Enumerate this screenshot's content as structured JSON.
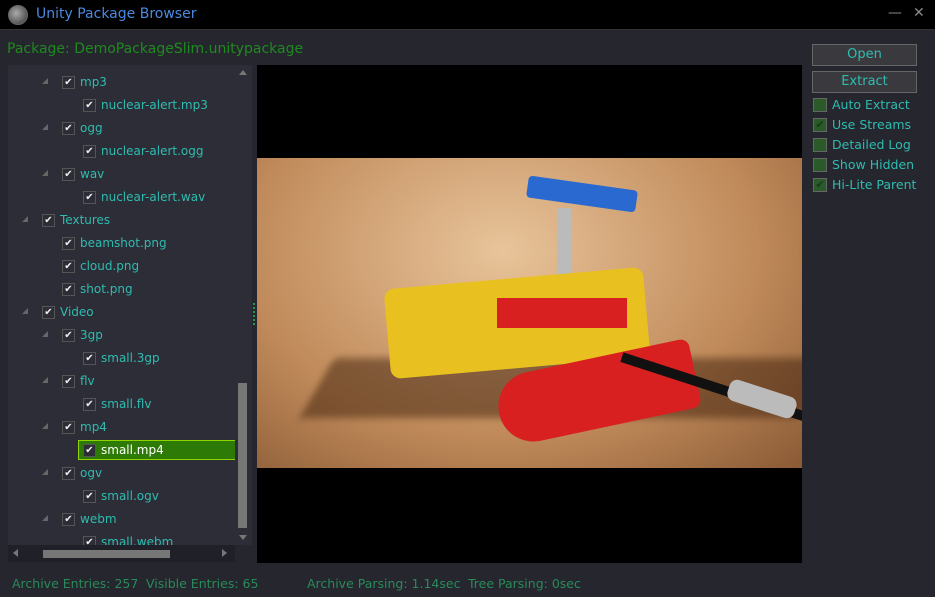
{
  "window": {
    "title": "Unity Package Browser",
    "minimize": "—",
    "close": "✕"
  },
  "package_label": "Package: DemoPackageSlim.unitypackage",
  "tree": [
    {
      "label": "mp3",
      "level": 1,
      "expander": true,
      "checked": true
    },
    {
      "label": "nuclear-alert.mp3",
      "level": 2,
      "expander": false,
      "checked": true
    },
    {
      "label": "ogg",
      "level": 1,
      "expander": true,
      "checked": true
    },
    {
      "label": "nuclear-alert.ogg",
      "level": 2,
      "expander": false,
      "checked": true
    },
    {
      "label": "wav",
      "level": 1,
      "expander": true,
      "checked": true
    },
    {
      "label": "nuclear-alert.wav",
      "level": 2,
      "expander": false,
      "checked": true
    },
    {
      "label": "Textures",
      "level": 0,
      "expander": true,
      "checked": true
    },
    {
      "label": "beamshot.png",
      "level": 1,
      "expander": false,
      "checked": true
    },
    {
      "label": "cloud.png",
      "level": 1,
      "expander": false,
      "checked": true
    },
    {
      "label": "shot.png",
      "level": 1,
      "expander": false,
      "checked": true
    },
    {
      "label": "Video",
      "level": 0,
      "expander": true,
      "checked": true
    },
    {
      "label": "3gp",
      "level": 1,
      "expander": true,
      "checked": true
    },
    {
      "label": "small.3gp",
      "level": 2,
      "expander": false,
      "checked": true
    },
    {
      "label": "flv",
      "level": 1,
      "expander": true,
      "checked": true
    },
    {
      "label": "small.flv",
      "level": 2,
      "expander": false,
      "checked": true
    },
    {
      "label": "mp4",
      "level": 1,
      "expander": true,
      "checked": true
    },
    {
      "label": "small.mp4",
      "level": 2,
      "expander": false,
      "checked": true,
      "selected": true
    },
    {
      "label": "ogv",
      "level": 1,
      "expander": true,
      "checked": true
    },
    {
      "label": "small.ogv",
      "level": 2,
      "expander": false,
      "checked": true
    },
    {
      "label": "webm",
      "level": 1,
      "expander": true,
      "checked": true
    },
    {
      "label": "small.webm",
      "level": 2,
      "expander": false,
      "checked": true
    }
  ],
  "buttons": {
    "open": "Open",
    "extract": "Extract"
  },
  "options": [
    {
      "label": "Auto Extract",
      "checked": false
    },
    {
      "label": "Use Streams",
      "checked": true
    },
    {
      "label": "Detailed Log",
      "checked": false
    },
    {
      "label": "Show Hidden",
      "checked": false
    },
    {
      "label": "Hi-Lite Parent",
      "checked": true
    }
  ],
  "status": {
    "archive_entries": "Archive Entries: 257",
    "visible_entries": "Visible Entries: 65",
    "archive_parsing": "Archive Parsing: 1.14sec",
    "tree_parsing": "Tree Parsing: 0sec"
  },
  "colors": {
    "accent": "#2fbcb0",
    "package_label": "#1f8a1f",
    "selection": "#2e7a06",
    "title": "#4a8ae0"
  }
}
